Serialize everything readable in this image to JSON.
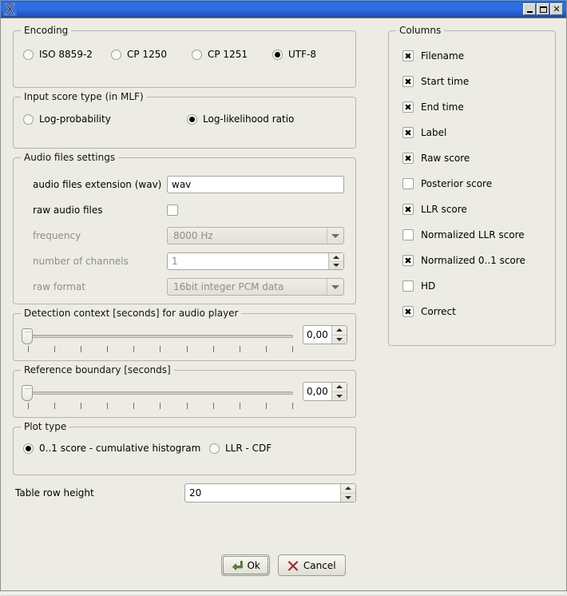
{
  "window": {
    "title": "",
    "icon": "x11-app-icon",
    "buttons": {
      "minimize": "minimize-icon",
      "maximize": "maximize-icon",
      "close": "close-icon"
    }
  },
  "encoding": {
    "title": "Encoding",
    "options": [
      {
        "label": "ISO 8859-2",
        "checked": false
      },
      {
        "label": "CP 1250",
        "checked": false
      },
      {
        "label": "CP 1251",
        "checked": false
      },
      {
        "label": "UTF-8",
        "checked": true
      }
    ]
  },
  "input_score_type": {
    "title": "Input score type (in MLF)",
    "options": [
      {
        "label": "Log-probability",
        "checked": false
      },
      {
        "label": "Log-likelihood ratio",
        "checked": true
      }
    ]
  },
  "audio_settings": {
    "title": "Audio files settings",
    "extension": {
      "label": "audio files extension (wav)",
      "value": "wav",
      "placeholder": ""
    },
    "raw_audio_files": {
      "label": "raw audio files",
      "checked": false
    },
    "frequency": {
      "label": "frequency",
      "value": "8000 Hz",
      "disabled": true
    },
    "number_of_channels": {
      "label": "number of channels",
      "value": "1",
      "disabled": true
    },
    "raw_format": {
      "label": "raw format",
      "value": "16bit integer PCM data",
      "disabled": true
    }
  },
  "detection_context": {
    "title": "Detection context [seconds] for audio player",
    "value": "0,00",
    "handle_position_percent": 0,
    "tick_count": 11
  },
  "reference_boundary": {
    "title": "Reference boundary [seconds]",
    "value": "0,00",
    "handle_position_percent": 0,
    "tick_count": 11
  },
  "plot_type": {
    "title": "Plot type",
    "options": [
      {
        "label": "0..1 score - cumulative histogram",
        "checked": true
      },
      {
        "label": "LLR - CDF",
        "checked": false
      }
    ]
  },
  "table_row_height": {
    "label": "Table row height",
    "value": "20"
  },
  "columns": {
    "title": "Columns",
    "items": [
      {
        "label": "Filename",
        "checked": true
      },
      {
        "label": "Start time",
        "checked": true
      },
      {
        "label": "End time",
        "checked": true
      },
      {
        "label": "Label",
        "checked": true
      },
      {
        "label": "Raw score",
        "checked": true
      },
      {
        "label": "Posterior score",
        "checked": false
      },
      {
        "label": "LLR score",
        "checked": true
      },
      {
        "label": "Normalized LLR score",
        "checked": false
      },
      {
        "label": "Normalized 0..1 score",
        "checked": true
      },
      {
        "label": "HD",
        "checked": false
      },
      {
        "label": "Correct",
        "checked": true
      }
    ]
  },
  "buttons": {
    "ok": {
      "label": "Ok",
      "icon": "enter-arrow-icon",
      "focused": true
    },
    "cancel": {
      "label": "Cancel",
      "icon": "x-cross-icon",
      "focused": false
    }
  },
  "checkmark_glyph": "✖",
  "colors": {
    "titlebar": "#2a6fe0",
    "dialog_bg": "#edece4",
    "disabled_text": "#8d8d86",
    "ok_icon": "#4f7a34",
    "cancel_icon": "#b02a2a"
  }
}
